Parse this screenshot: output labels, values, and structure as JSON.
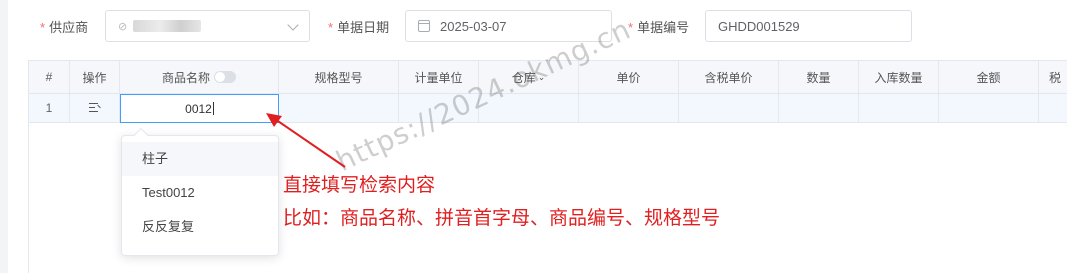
{
  "form": {
    "supplier": {
      "label": "供应商",
      "value": ""
    },
    "date": {
      "label": "单据日期",
      "value": "2025-03-07"
    },
    "number": {
      "label": "单据编号",
      "value": "GHDD001529"
    }
  },
  "table": {
    "headers": [
      "#",
      "操作",
      "商品名称",
      "规格型号",
      "计量单位",
      "仓库",
      "单价",
      "含税单价",
      "数量",
      "入库数量",
      "金额",
      "税"
    ],
    "rows": [
      {
        "index": "1",
        "product_name": "0012"
      }
    ]
  },
  "dropdown": {
    "items": [
      "柱子",
      "Test0012",
      "反反复复"
    ]
  },
  "annotation": {
    "line1": "直接填写检索内容",
    "line2": "比如：商品名称、拼音首字母、商品编号、规格型号",
    "color": "#e02020"
  },
  "watermark": "https://2024.okmg.cn"
}
